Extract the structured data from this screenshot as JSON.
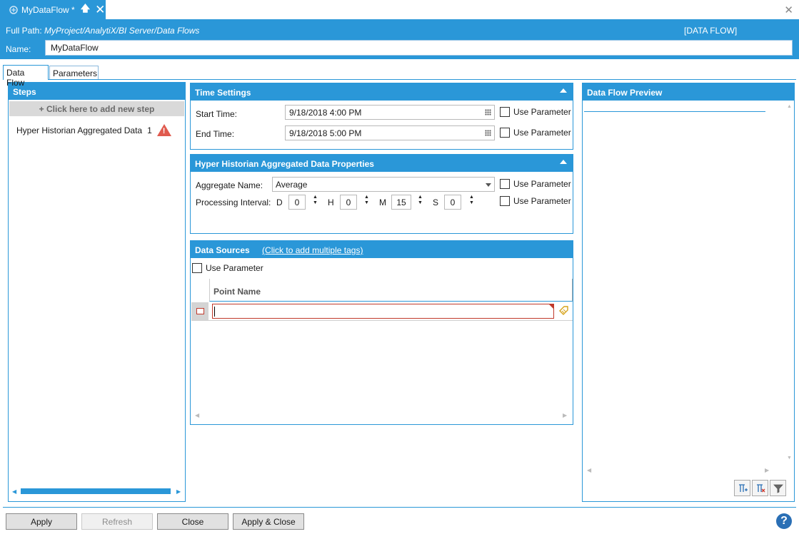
{
  "document_tab": {
    "title": "MyDataFlow *",
    "pin_glyph": "🡅",
    "close_glyph": "✕"
  },
  "window": {
    "close_glyph": "✕"
  },
  "header": {
    "full_path_label": "Full Path:",
    "full_path_value": "MyProject/AnalytiX/BI Server/Data Flows",
    "type_label": "[DATA FLOW]",
    "name_label": "Name:",
    "name_value": "MyDataFlow"
  },
  "tabs": [
    {
      "label": "Data Flow",
      "active": true
    },
    {
      "label": "Parameters",
      "active": false
    }
  ],
  "steps": {
    "title": "Steps",
    "add_step_label": "+ Click here to add new step",
    "items": [
      {
        "label": "Hyper Historian Aggregated Data",
        "count": "1",
        "status": "warning"
      }
    ]
  },
  "time_settings": {
    "title": "Time Settings",
    "start_label": "Start Time:",
    "start_value": "9/18/2018 4:00 PM",
    "end_label": "End Time:",
    "end_value": "9/18/2018 5:00 PM",
    "use_parameter_label": "Use Parameter"
  },
  "aggregated_props": {
    "title": "Hyper Historian Aggregated Data Properties",
    "aggregate_label": "Aggregate Name:",
    "aggregate_value": "Average",
    "interval_label": "Processing Interval:",
    "d_label": "D",
    "d_value": "0",
    "h_label": "H",
    "h_value": "0",
    "m_label": "M",
    "m_value": "15",
    "s_label": "S",
    "s_value": "0",
    "use_parameter_label": "Use Parameter"
  },
  "data_sources": {
    "title": "Data Sources",
    "link_label": "(Click to add multiple tags)",
    "use_parameter_label": "Use Parameter",
    "column_header": "Point Name",
    "rows": [
      {
        "point_name": ""
      }
    ]
  },
  "preview": {
    "title": "Data Flow Preview"
  },
  "footer": {
    "apply_label": "Apply",
    "refresh_label": "Refresh",
    "close_label": "Close",
    "apply_close_label": "Apply & Close",
    "help_glyph": "?"
  },
  "colors": {
    "accent": "#2a97d8",
    "error": "#c0392b",
    "warning": "#e05a4e"
  }
}
